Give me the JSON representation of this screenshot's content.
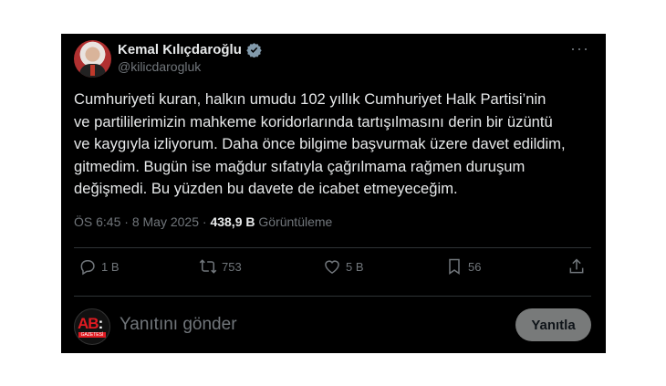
{
  "author": {
    "name": "Kemal Kılıçdaroğlu",
    "handle": "@kilicdarogluk"
  },
  "tweet": {
    "lines": [
      "Cumhuriyeti kuran, halkın umudu 102 yıllık Cumhuriyet Halk Partisi’nin",
      "ve partililerimizin mahkeme koridorlarında tartışılmasını derin bir üzüntü",
      "ve kaygıyla izliyorum. Daha önce bilgime başvurmak üzere davet edildim,",
      "gitmedim. Bugün ise mağdur sıfatıyla çağrılmama rağmen duruşum",
      "değişmedi. Bu yüzden bu davete de icabet etmeyeceğim."
    ],
    "time": "ÖS 6:45",
    "separator1": "·",
    "date": "8 May 2025",
    "separator2": "·",
    "views_count": "438,9 B",
    "views_label": "Görüntüleme"
  },
  "actions": {
    "replies": "1 B",
    "reposts": "753",
    "likes": "5 B",
    "bookmarks": "56"
  },
  "reply": {
    "avatar_text_red": "AB",
    "avatar_text_white": ":",
    "avatar_caption": "GAZETESİ",
    "placeholder": "Yanıtını gönder",
    "button_label": "Yanıtla"
  },
  "colors": {
    "background": "#000000",
    "text": "#e7e9ea",
    "muted": "#71767b",
    "verified": "#829aab",
    "button": "#787a7a"
  },
  "icons": [
    "verified-badge-icon",
    "more-icon",
    "reply-icon",
    "repost-icon",
    "like-icon",
    "bookmark-icon",
    "share-icon"
  ]
}
